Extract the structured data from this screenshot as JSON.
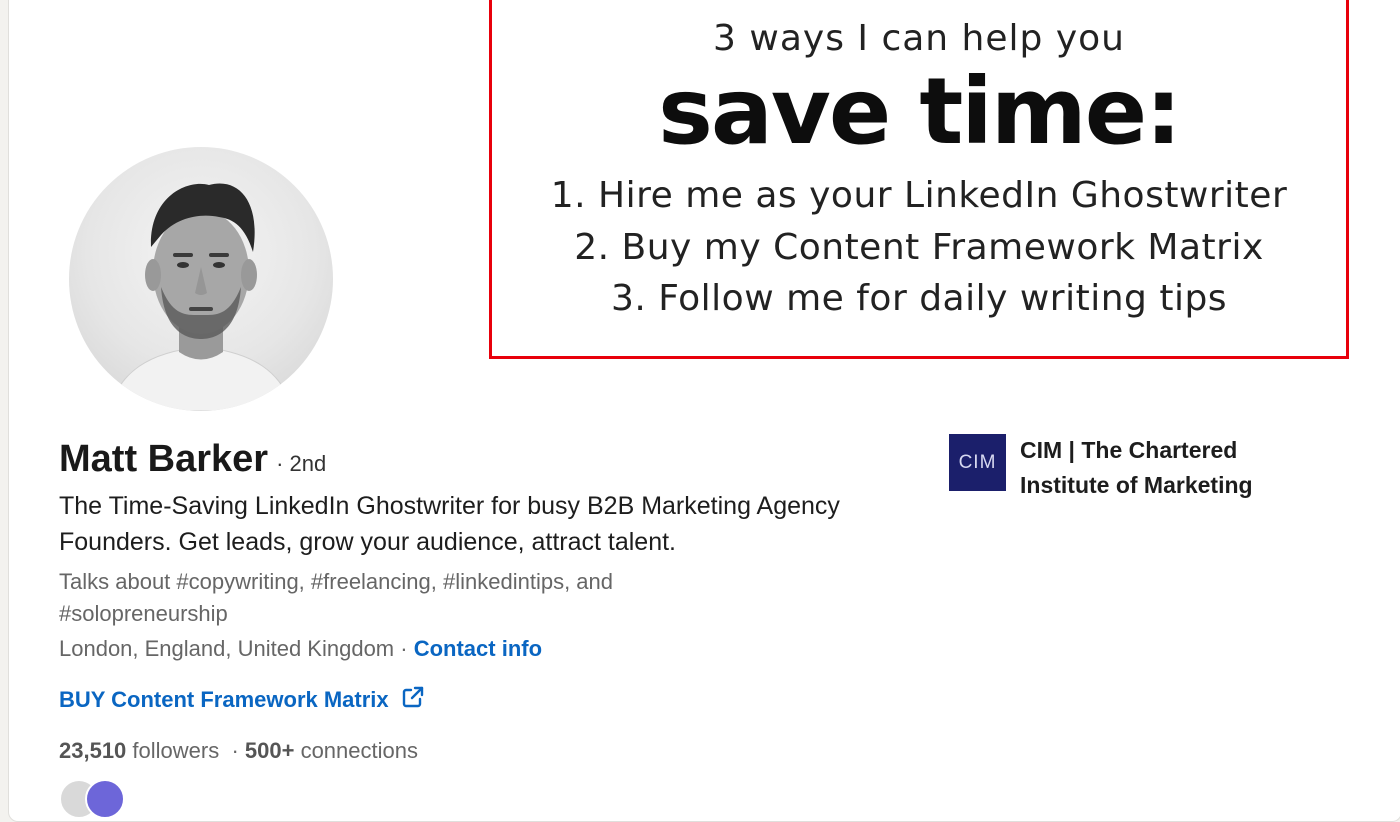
{
  "banner": {
    "intro": "3 ways I can help you",
    "headline": "save time:",
    "items": [
      "1. Hire me as your LinkedIn Ghostwriter",
      "2. Buy my Content Framework Matrix",
      "3. Follow me for daily writing tips"
    ],
    "border_color": "#e8000b"
  },
  "profile": {
    "name": "Matt Barker",
    "degree": "· 2nd",
    "headline": "The Time-Saving LinkedIn Ghostwriter for busy B2B Marketing Agency Founders. Get leads, grow your audience, attract talent.",
    "talks_about": "Talks about #copywriting, #freelancing, #linkedintips, and #solopreneurship",
    "location": "London, England, United Kingdom",
    "separator": " · ",
    "contact_label": "Contact info",
    "website_label": "BUY Content Framework Matrix",
    "followers_count": "23,510",
    "followers_label": " followers",
    "stats_separator": "  · ",
    "connections_count": "500+",
    "connections_label": " connections"
  },
  "company": {
    "logo_text": "CIM",
    "name": "CIM | The Chartered Institute of Marketing",
    "logo_color": "#1b1f6b"
  },
  "colors": {
    "link": "#0a66c2",
    "secondary_text": "#666666"
  },
  "icons": {
    "external_link": "external-link-icon"
  }
}
